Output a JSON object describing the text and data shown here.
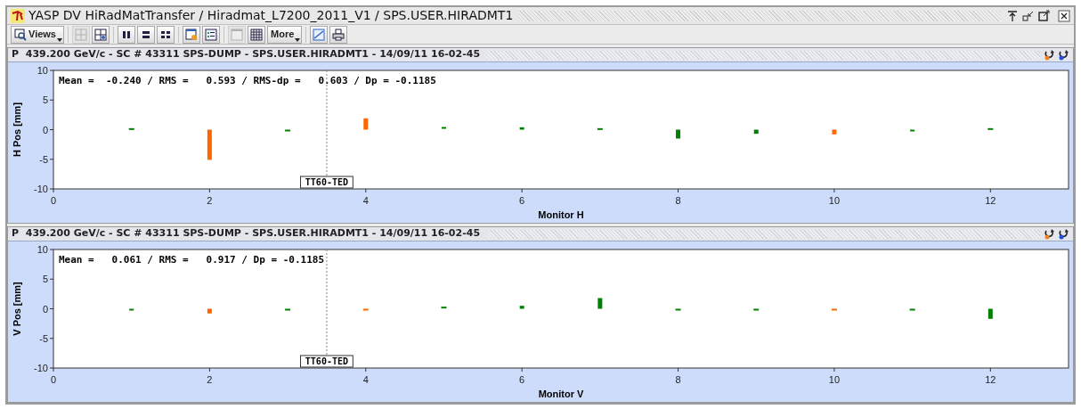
{
  "window": {
    "title": "YASP DV HiRadMatTransfer / Hiradmat_L7200_2011_V1 / SPS.USER.HIRADMT1"
  },
  "toolbar": [
    {
      "kind": "views",
      "label": "Views",
      "disabled": false
    },
    {
      "kind": "grid",
      "disabled": true
    },
    {
      "kind": "layout",
      "disabled": false
    },
    {
      "kind": "columns",
      "disabled": false
    },
    {
      "kind": "rows",
      "disabled": false
    },
    {
      "kind": "tiles",
      "disabled": false
    },
    {
      "kind": "settings",
      "disabled": false
    },
    {
      "kind": "list",
      "disabled": false
    },
    {
      "kind": "window",
      "disabled": true
    },
    {
      "kind": "table",
      "disabled": false
    },
    {
      "kind": "more",
      "label": "More",
      "disabled": false
    },
    {
      "kind": "export",
      "disabled": false
    },
    {
      "kind": "print",
      "disabled": false
    }
  ],
  "panels": [
    {
      "header": "P  439.200 GeV/c - SC # 43311 SPS-DUMP - SPS.USER.HIRADMT1 - 14/09/11 16-02-45",
      "stats": "Mean =  -0.240 / RMS =   0.593 / RMS-dp =   0.603 / Dp = -0.1185",
      "chart_data": {
        "type": "bar",
        "xlabel": "Monitor H",
        "ylabel": "H Pos [mm]",
        "x": [
          1,
          2,
          3,
          4,
          5,
          6,
          7,
          8,
          9,
          10,
          11,
          12
        ],
        "series": [
          {
            "color": "#008000",
            "values": [
              0.1,
              null,
              -0.2,
              null,
              0.3,
              0.4,
              0.1,
              -1.5,
              -0.7,
              null,
              -0.3,
              0.1
            ]
          },
          {
            "color": "#ff6600",
            "values": [
              null,
              -5.1,
              null,
              1.9,
              null,
              null,
              null,
              null,
              null,
              -0.8,
              null,
              null
            ]
          }
        ],
        "xlim": [
          0,
          13
        ],
        "ylim": [
          -10,
          10
        ],
        "xticks": [
          0,
          2,
          4,
          6,
          8,
          10,
          12
        ],
        "yticks": [
          -10,
          -5,
          0,
          5,
          10
        ],
        "ref_lines": [
          {
            "axis": "x",
            "value": 3.5,
            "label": "TT60-TED"
          }
        ]
      }
    },
    {
      "header": "P  439.200 GeV/c - SC # 43311 SPS-DUMP - SPS.USER.HIRADMT1 - 14/09/11 16-02-45",
      "stats": "Mean =   0.061 / RMS =   0.917 / Dp = -0.1185",
      "chart_data": {
        "type": "bar",
        "xlabel": "Monitor V",
        "ylabel": "V Pos [mm]",
        "x": [
          1,
          2,
          3,
          4,
          5,
          6,
          7,
          8,
          9,
          10,
          11,
          12
        ],
        "series": [
          {
            "color": "#008000",
            "values": [
              -0.3,
              null,
              -0.1,
              null,
              0.2,
              0.5,
              1.8,
              -0.1,
              -0.1,
              null,
              -0.1,
              -1.7
            ]
          },
          {
            "color": "#ff6600",
            "values": [
              null,
              -0.8,
              null,
              -0.1,
              null,
              null,
              null,
              null,
              null,
              -0.2,
              null,
              null
            ]
          }
        ],
        "xlim": [
          0,
          13
        ],
        "ylim": [
          -10,
          10
        ],
        "xticks": [
          0,
          2,
          4,
          6,
          8,
          10,
          12
        ],
        "yticks": [
          -10,
          -5,
          0,
          5,
          10
        ],
        "ref_lines": [
          {
            "axis": "x",
            "value": 3.5,
            "label": "TT60-TED"
          }
        ]
      }
    }
  ]
}
